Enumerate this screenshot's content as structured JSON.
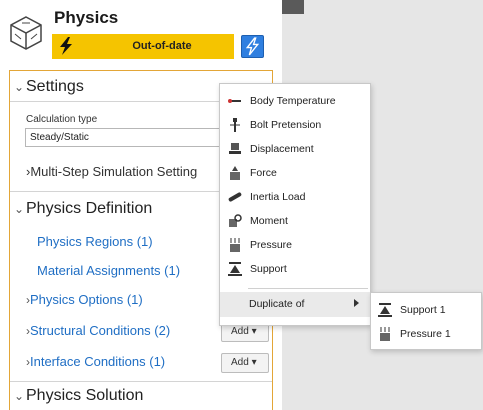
{
  "header": {
    "title": "Physics",
    "status": "Out-of-date",
    "status_color": "#f5c400",
    "update_icon": "lightning-icon"
  },
  "settings": {
    "heading": "Settings",
    "calc_label": "Calculation type",
    "calc_value": "Steady/Static",
    "multi_step": "Multi-Step Simulation Setting"
  },
  "definition": {
    "heading": "Physics Definition",
    "regions": "Physics Regions (1)",
    "materials": "Material Assignments (1)",
    "options": "Physics Options (1)",
    "structural": "Structural Conditions (2)",
    "interface": "Interface Conditions (1)",
    "add_label": "Add"
  },
  "solution": {
    "heading": "Physics Solution"
  },
  "menu": {
    "items": [
      {
        "label": "Body Temperature",
        "icon": "thermometer-icon"
      },
      {
        "label": "Bolt Pretension",
        "icon": "bolt-icon"
      },
      {
        "label": "Displacement",
        "icon": "displacement-icon"
      },
      {
        "label": "Force",
        "icon": "force-icon"
      },
      {
        "label": "Inertia Load",
        "icon": "inertia-icon"
      },
      {
        "label": "Moment",
        "icon": "moment-icon"
      },
      {
        "label": "Pressure",
        "icon": "pressure-icon"
      },
      {
        "label": "Support",
        "icon": "support-icon"
      }
    ],
    "duplicate_label": "Duplicate of"
  },
  "submenu": {
    "items": [
      {
        "label": "Support 1",
        "icon": "support-icon"
      },
      {
        "label": "Pressure 1",
        "icon": "pressure-icon"
      }
    ]
  },
  "accent_color": "#e3a637",
  "link_color": "#1f6ec4"
}
